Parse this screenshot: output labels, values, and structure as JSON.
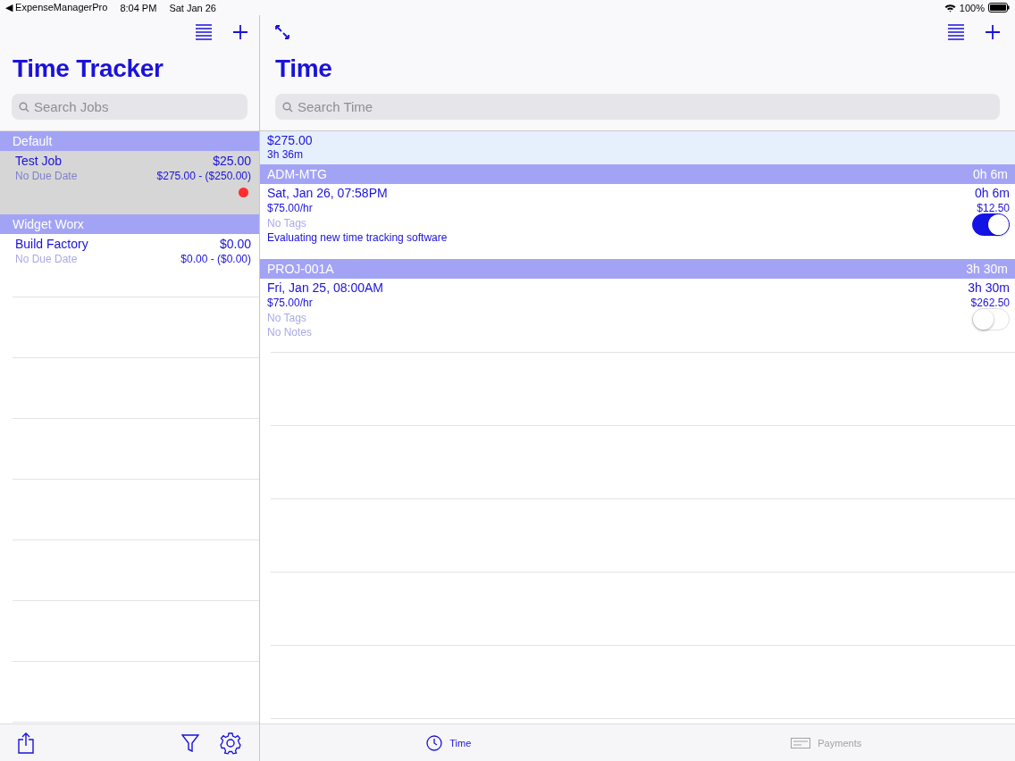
{
  "status_bar": {
    "back_app": "◀ ExpenseManagerPro",
    "time": "8:04 PM",
    "date": "Sat Jan 26",
    "battery": "100%"
  },
  "jobs": {
    "title": "Time Tracker",
    "search": {
      "placeholder": "Search Jobs"
    },
    "groups": [
      {
        "name": "Default",
        "jobs": [
          {
            "name": "Test Job",
            "amount": "$25.00",
            "due": "No Due Date",
            "balance": "$275.00 - ($250.00)",
            "selected": true,
            "flagged": true
          }
        ]
      },
      {
        "name": "Widget Worx",
        "jobs": [
          {
            "name": "Build Factory",
            "amount": "$0.00",
            "due": "No Due Date",
            "balance": "$0.00 - ($0.00)",
            "selected": false,
            "flagged": false
          }
        ]
      }
    ]
  },
  "time": {
    "title": "Time",
    "search": {
      "placeholder": "Search Time"
    },
    "summary": {
      "total": "$275.00",
      "duration": "3h 36m"
    },
    "groups": [
      {
        "name": "ADM-MTG",
        "duration": "0h 6m",
        "entries": [
          {
            "date": "Sat, Jan 26, 07:58PM",
            "duration": "0h 6m",
            "rate": "$75.00/hr",
            "amount": "$12.50",
            "tags": {
              "text": "No Tags",
              "empty": true
            },
            "notes": {
              "text": "Evaluating new time tracking software",
              "empty": false
            },
            "on": true
          }
        ]
      },
      {
        "name": "PROJ-001A",
        "duration": "3h 30m",
        "entries": [
          {
            "date": "Fri, Jan 25, 08:00AM",
            "duration": "3h 30m",
            "rate": "$75.00/hr",
            "amount": "$262.50",
            "tags": {
              "text": "No Tags",
              "empty": true
            },
            "notes": {
              "text": "No Notes",
              "empty": true
            },
            "on": false
          }
        ]
      }
    ]
  },
  "tabs": [
    {
      "label": "Time",
      "selected": true
    },
    {
      "label": "Payments",
      "selected": false
    }
  ]
}
